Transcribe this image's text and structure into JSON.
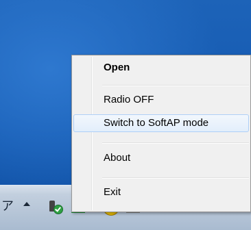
{
  "taskbar": {
    "partial_label": "ア"
  },
  "context_menu": {
    "items": [
      {
        "label": "Open",
        "bold": true
      },
      {
        "label": "Radio OFF"
      },
      {
        "label": "Switch to SoftAP mode",
        "hovered": true
      },
      {
        "label": "About"
      },
      {
        "label": "Exit"
      }
    ]
  },
  "tray_icons": [
    "show-hidden-icons-chevron-icon",
    "usb-wireless-adapter-icon",
    "green-signal-strength-icon",
    "yellow-shield-download-icon",
    "white-signal-strength-icon"
  ],
  "colors": {
    "desktop": "#1358b0",
    "menu_background": "#f0f0f0",
    "hover_highlight": "#e2eefb",
    "hover_border": "#aecff7"
  }
}
